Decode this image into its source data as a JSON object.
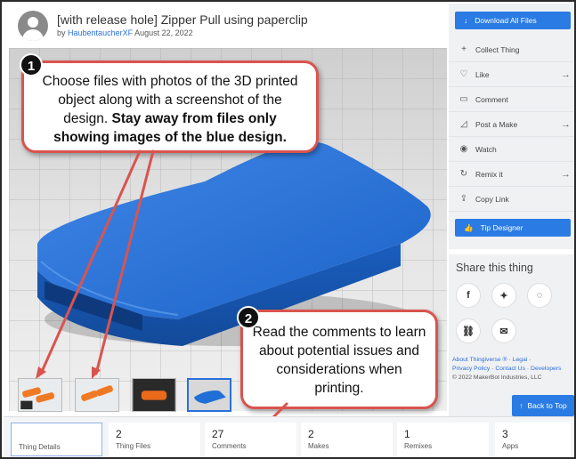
{
  "header": {
    "title": "[with release hole] Zipper Pull using paperclip",
    "by_prefix": "by",
    "author": "HaubentaucherXF",
    "date": "August 22, 2022"
  },
  "sidebar": {
    "download_label": "Download All Files",
    "items": [
      {
        "label": "Collect Thing",
        "icon": "plus-icon",
        "has_arrow": false
      },
      {
        "label": "Like",
        "icon": "heart-icon",
        "has_arrow": true
      },
      {
        "label": "Comment",
        "icon": "comment-icon",
        "has_arrow": false
      },
      {
        "label": "Post a Make",
        "icon": "make-icon",
        "has_arrow": true
      },
      {
        "label": "Watch",
        "icon": "eye-icon",
        "has_arrow": false
      },
      {
        "label": "Remix it",
        "icon": "remix-icon",
        "has_arrow": true
      },
      {
        "label": "Copy Link",
        "icon": "share-icon",
        "has_arrow": false
      }
    ],
    "tip_label": "Tip Designer",
    "share_title": "Share this thing",
    "footer": {
      "about": "About Thingiverse ®",
      "legal": "Legal",
      "privacy": "Privacy Policy",
      "contact": "Contact Us",
      "developers": "Developers",
      "copyright": "© 2022 MakerBot Industries, LLC"
    },
    "back_to_top_label": "Back to Top"
  },
  "callouts": {
    "one": {
      "badge": "1",
      "text": "Choose files with photos of the 3D printed object along with a screenshot of the design.",
      "bold": "Stay away from files only showing images of the blue design."
    },
    "two": {
      "badge": "2",
      "text": "Read the comments to learn about potential issues and considerations when printing."
    }
  },
  "tabs": [
    {
      "count": "",
      "label": "Thing Details",
      "active": true
    },
    {
      "count": "2",
      "label": "Thing Files",
      "active": false
    },
    {
      "count": "27",
      "label": "Comments",
      "active": false
    },
    {
      "count": "2",
      "label": "Makes",
      "active": false
    },
    {
      "count": "1",
      "label": "Remixes",
      "active": false
    },
    {
      "count": "3",
      "label": "Apps",
      "active": false
    }
  ],
  "thumbnails": [
    {
      "icon": "orange-print-photo",
      "selected": false
    },
    {
      "icon": "orange-print-photo",
      "selected": false
    },
    {
      "icon": "orange-print-dark-photo",
      "selected": false
    },
    {
      "icon": "blue-design-render",
      "selected": true
    }
  ],
  "colors": {
    "accent": "#2a7be4",
    "callout_border": "#d9544f",
    "model_blue": "#1f6fd6",
    "print_orange": "#f07a24"
  }
}
